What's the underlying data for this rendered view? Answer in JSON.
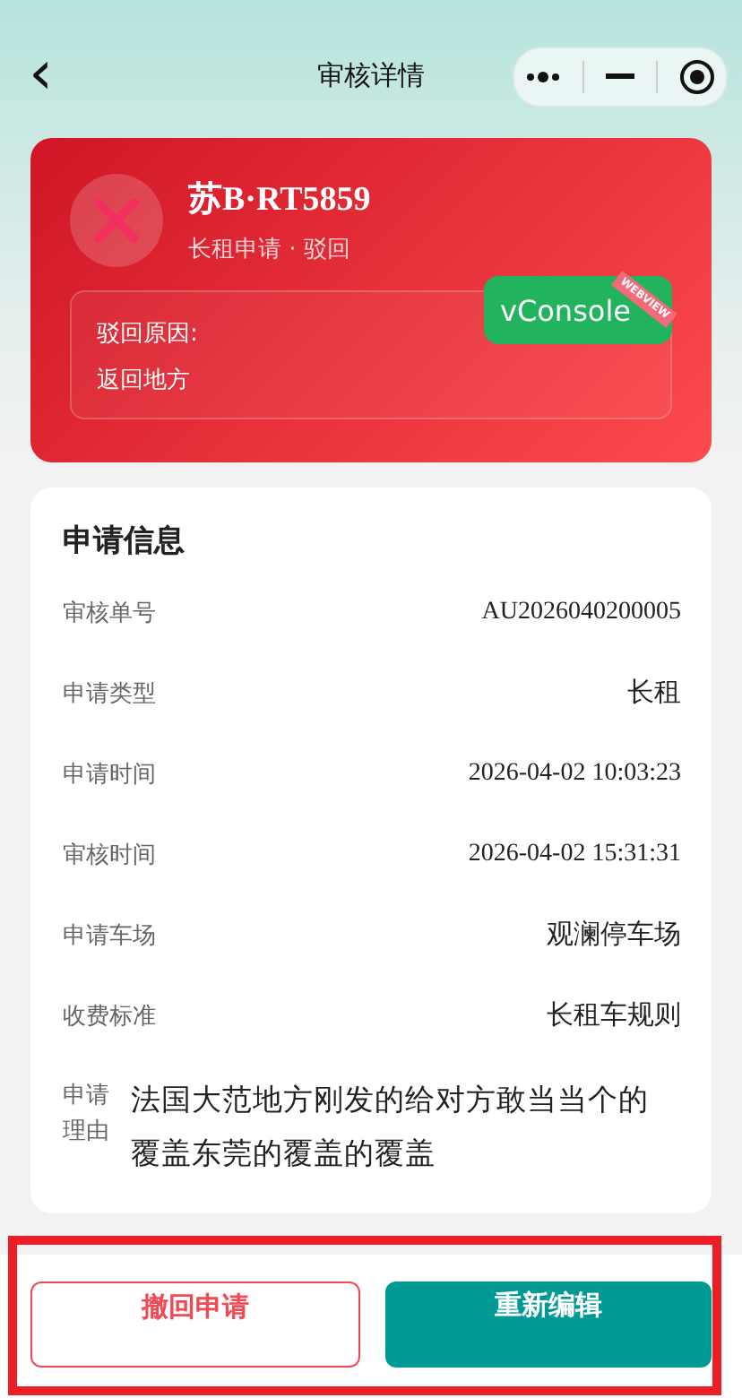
{
  "nav": {
    "back": "‹",
    "title": "审核详情"
  },
  "status": {
    "kind": "rejected",
    "plate": "苏B·RT5859",
    "subtitle": "长租申请 · 驳回",
    "reason_label": "驳回原因:",
    "reason": "返回地方"
  },
  "vconsole": {
    "label": "vConsole",
    "ribbon": "WEBVIEW"
  },
  "info": {
    "title": "申请信息",
    "rows": [
      {
        "label": "审核单号",
        "value": "AU2026040200005",
        "kind": "serif"
      },
      {
        "label": "申请类型",
        "value": "长租",
        "kind": "sans"
      },
      {
        "label": "申请时间",
        "value": "2026-04-02 10:03:23",
        "kind": "serif"
      },
      {
        "label": "审核时间",
        "value": "2026-04-02 15:31:31",
        "kind": "serif"
      },
      {
        "label": "申请车场",
        "value": "观澜停车场",
        "kind": "sans"
      },
      {
        "label": "收费标准",
        "value": "长租车规则",
        "kind": "sans"
      },
      {
        "label": "申请理由",
        "value": "法国大范地方刚发的给对方敢当当个的覆盖东莞的覆盖的覆盖",
        "kind": "long"
      }
    ]
  },
  "actions": [
    {
      "label": "撤回申请",
      "kind": "outline"
    },
    {
      "label": "重新编辑",
      "kind": "primary"
    }
  ]
}
